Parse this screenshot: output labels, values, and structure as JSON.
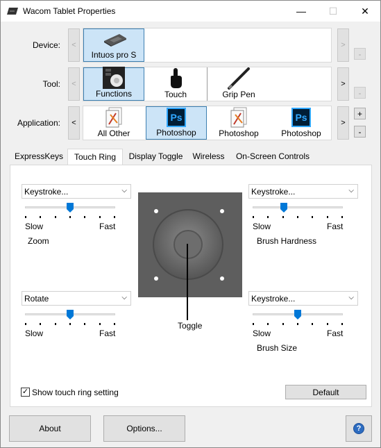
{
  "window": {
    "title": "Wacom Tablet Properties"
  },
  "titlebar": {
    "min": "—",
    "max": "☐",
    "close": "✕"
  },
  "labels": {
    "device": "Device:",
    "tool": "Tool:",
    "application": "Application:"
  },
  "device": {
    "items": [
      {
        "label": "Intuos pro S",
        "icon": "tablet-icon",
        "selected": true
      }
    ]
  },
  "tool": {
    "items": [
      {
        "label": "Functions",
        "icon": "functions-icon",
        "selected": true
      },
      {
        "label": "Touch",
        "icon": "touch-hand-icon",
        "selected": false
      },
      {
        "label": "Grip Pen",
        "icon": "pen-icon",
        "selected": false
      }
    ]
  },
  "application": {
    "items": [
      {
        "label": "All Other",
        "icon": "all-other-apps-icon",
        "selected": false
      },
      {
        "label": "Photoshop",
        "icon": "photoshop-icon",
        "selected": true
      },
      {
        "label": "Photoshop",
        "icon": "photoshop-grey-icon",
        "selected": false
      },
      {
        "label": "Photoshop",
        "icon": "photoshop-icon",
        "selected": false
      }
    ]
  },
  "arrows": {
    "left": "<",
    "right": ">"
  },
  "side_buttons": {
    "minus": "-",
    "plus": "+"
  },
  "ps_glyph": "Ps",
  "tabs": [
    {
      "label": "ExpressKeys",
      "active": false
    },
    {
      "label": "Touch Ring",
      "active": true
    },
    {
      "label": "Display Toggle",
      "active": false
    },
    {
      "label": "Wireless",
      "active": false
    },
    {
      "label": "On-Screen Controls",
      "active": false
    }
  ],
  "panel": {
    "top_left": {
      "dropdown": "Keystroke...",
      "slow": "Slow",
      "fast": "Fast",
      "function": "Zoom",
      "speed_level": 0.5
    },
    "top_right": {
      "dropdown": "Keystroke...",
      "slow": "Slow",
      "fast": "Fast",
      "function": "Brush Hardness",
      "speed_level": 0.33
    },
    "bottom_left": {
      "dropdown": "Rotate",
      "slow": "Slow",
      "fast": "Fast",
      "speed_level": 0.5
    },
    "bottom_right": {
      "dropdown": "Keystroke...",
      "slow": "Slow",
      "fast": "Fast",
      "function": "Brush Size",
      "speed_level": 0.5
    },
    "toggle_label": "Toggle",
    "show_setting": {
      "label": "Show touch ring setting",
      "checked": true,
      "mark": "✓"
    },
    "default_button": "Default"
  },
  "footer": {
    "about": "About",
    "options": "Options...",
    "help": "?"
  },
  "colors": {
    "accent": "#0078d7",
    "selection_bg": "#cce4f7",
    "ps_blue": "#001e36",
    "ps_text": "#31a8ff"
  }
}
